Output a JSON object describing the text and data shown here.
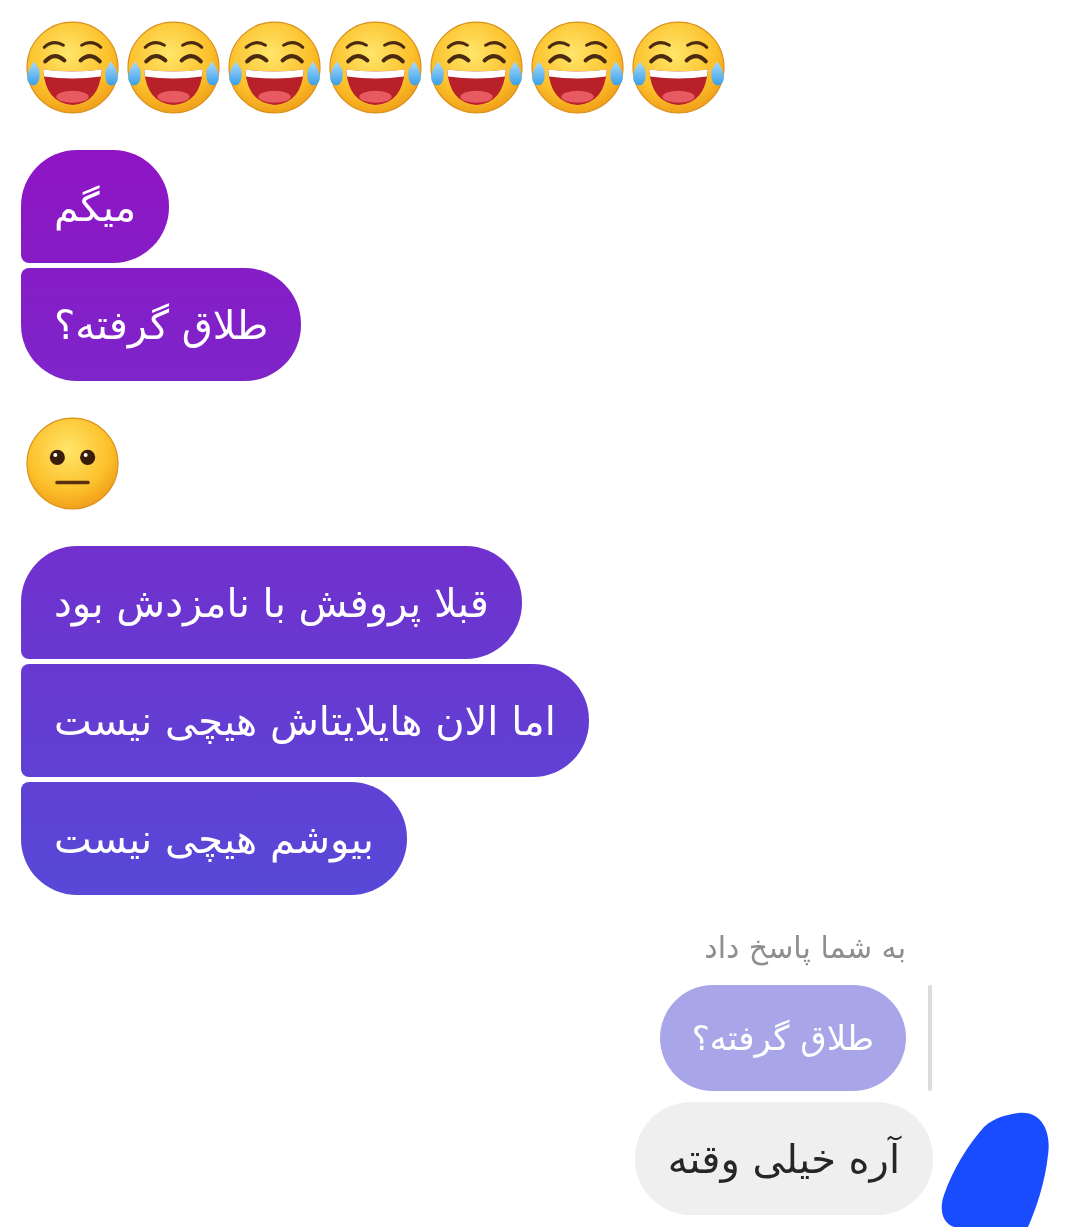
{
  "messages": [
    {
      "kind": "emoji",
      "outgoing": true,
      "emojis": [
        {
          "kind": "laughing_tears"
        },
        {
          "kind": "laughing_tears"
        },
        {
          "kind": "laughing_tears"
        },
        {
          "kind": "laughing_tears"
        },
        {
          "kind": "laughing_tears"
        },
        {
          "kind": "laughing_tears"
        },
        {
          "kind": "laughing_tears"
        }
      ]
    },
    {
      "kind": "text",
      "outgoing": true,
      "text": "میگم"
    },
    {
      "kind": "text",
      "outgoing": true,
      "text": "طلاق گرفته؟"
    },
    {
      "kind": "emoji",
      "outgoing": true,
      "emojis": [
        {
          "kind": "neutral"
        }
      ]
    },
    {
      "kind": "text",
      "outgoing": true,
      "text": "قبلا پروفش با نامزدش بود"
    },
    {
      "kind": "text",
      "outgoing": true,
      "text": "اما الان هایلایتاش هیچی نیست"
    },
    {
      "kind": "text",
      "outgoing": true,
      "text": "بیوشم هیچی نیست"
    },
    {
      "kind": "text",
      "outgoing": false,
      "reply_note": "به شما پاسخ داد",
      "reply_to": "طلاق گرفته؟",
      "text": "آره خیلی وقته"
    }
  ]
}
